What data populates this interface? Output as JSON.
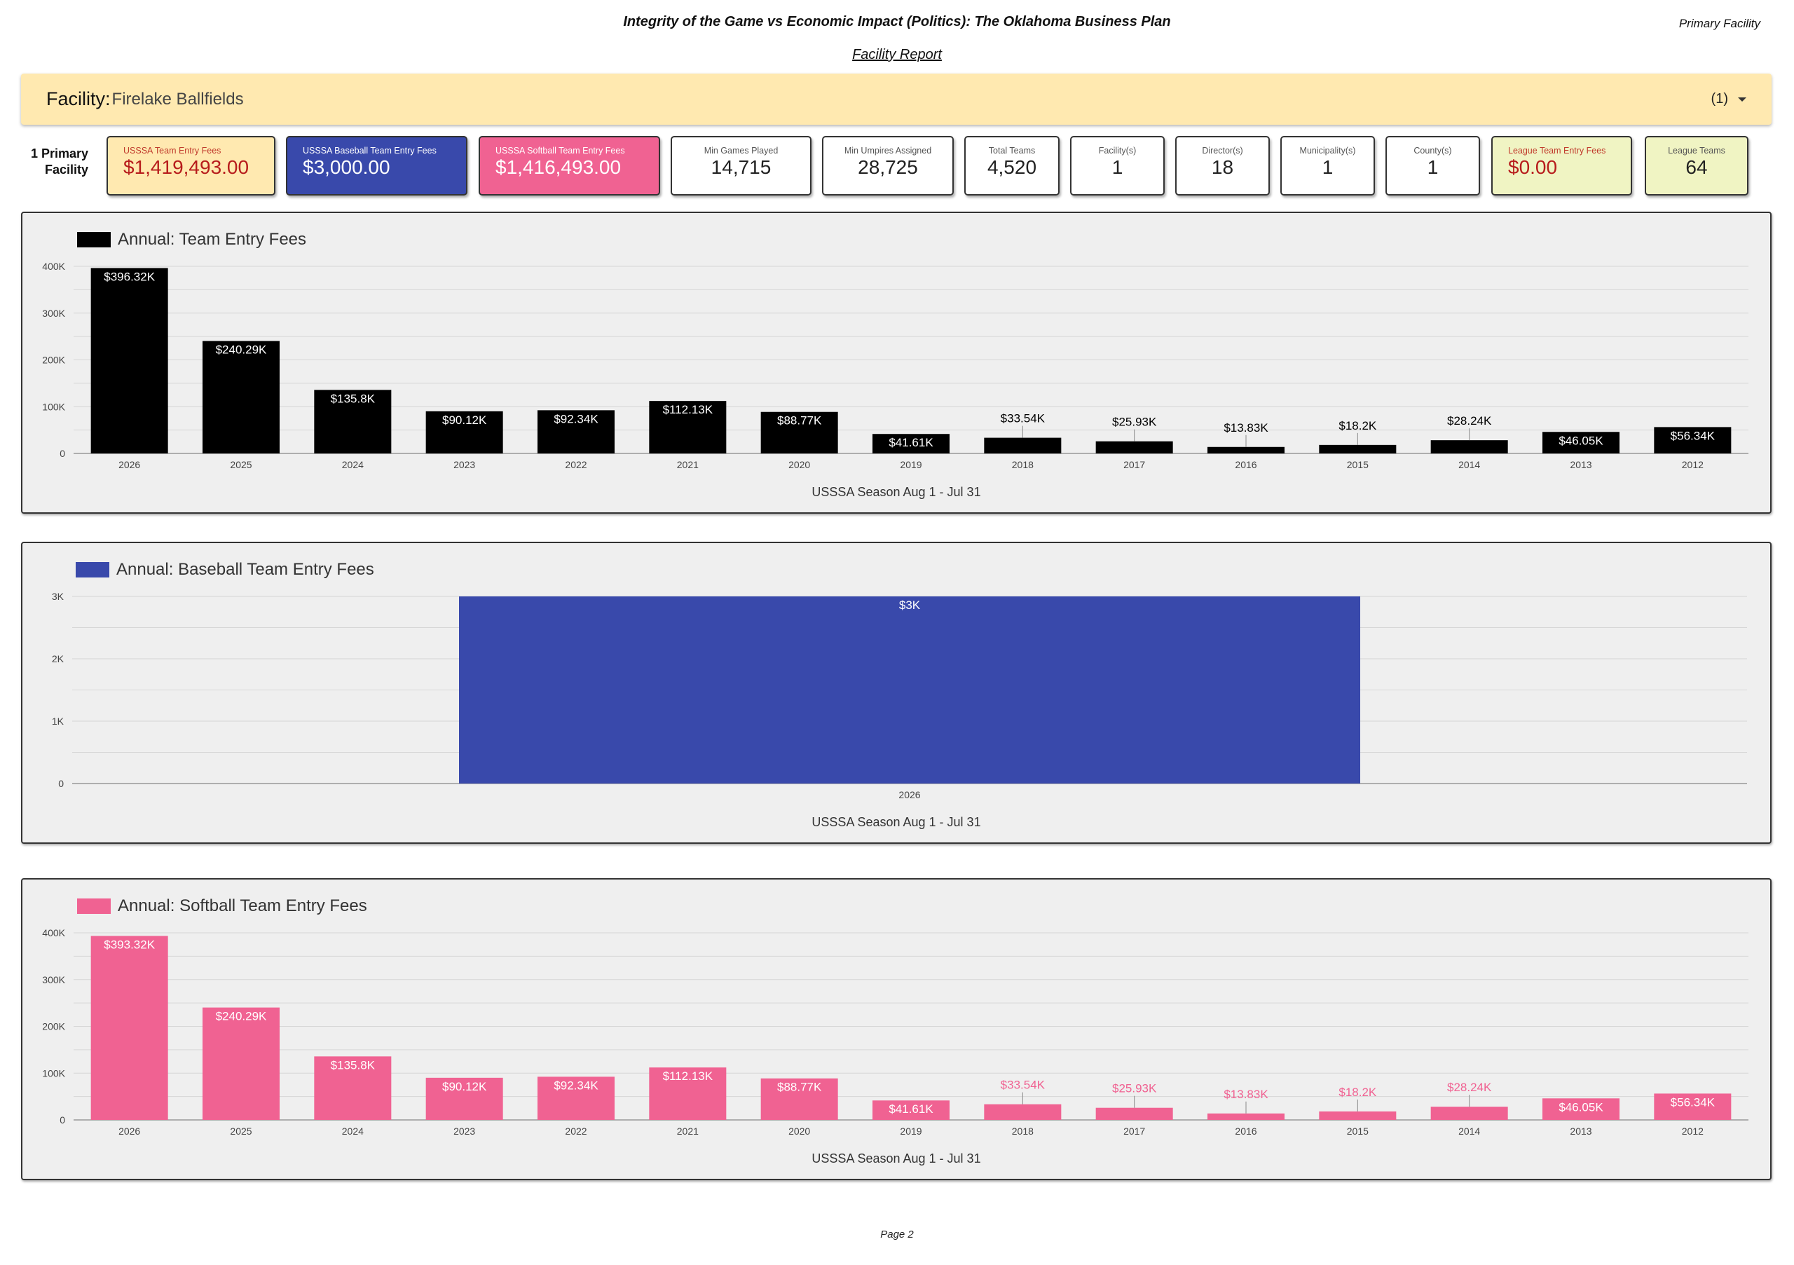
{
  "header": {
    "title": "Integrity of the Game vs Economic Impact (Politics): The Oklahoma Business Plan",
    "tag": "Primary Facility",
    "subtitle": "Facility Report"
  },
  "facility": {
    "label": "Facility",
    "separator": ":",
    "value": "Firelake Ballfields",
    "count": "(1)"
  },
  "side_label": {
    "line1": "1 Primary",
    "line2": "Facility"
  },
  "cards": [
    {
      "label": "USSSA Team Entry Fees",
      "value": "$1,419,493.00"
    },
    {
      "label": "USSSA Baseball Team Entry Fees",
      "value": "$3,000.00"
    },
    {
      "label": "USSSA Softball Team Entry Fees",
      "value": "$1,416,493.00"
    },
    {
      "label": "Min Games Played",
      "value": "14,715"
    },
    {
      "label": "Min Umpires Assigned",
      "value": "28,725"
    },
    {
      "label": "Total Teams",
      "value": "4,520"
    },
    {
      "label": "Facility(s)",
      "value": "1"
    },
    {
      "label": "Director(s)",
      "value": "18"
    },
    {
      "label": "Municipality(s)",
      "value": "1"
    },
    {
      "label": "County(s)",
      "value": "1"
    },
    {
      "label": "League Team Entry Fees",
      "value": "$0.00"
    },
    {
      "label": "League Teams",
      "value": "64"
    }
  ],
  "colors": {
    "total": "#000000",
    "baseball": "#3949ab",
    "softball": "#f06292",
    "facility_bg": "#ffe9b0"
  },
  "chart_data": [
    {
      "type": "bar",
      "title": "Annual: Team Entry Fees",
      "xlabel": "USSSA Season Aug 1 - Jul 31",
      "ylabel": "",
      "ylim": [
        0,
        400000
      ],
      "yticks": [
        0,
        100000,
        200000,
        300000,
        400000
      ],
      "ytick_labels": [
        "0",
        "100K",
        "200K",
        "300K",
        "400K"
      ],
      "grid": true,
      "legend": "top-left",
      "color": "#000000",
      "categories": [
        "2026",
        "2025",
        "2024",
        "2023",
        "2022",
        "2021",
        "2020",
        "2019",
        "2018",
        "2017",
        "2016",
        "2015",
        "2014",
        "2013",
        "2012"
      ],
      "values": [
        396320,
        240290,
        135800,
        90120,
        92340,
        112130,
        88770,
        41610,
        33540,
        25930,
        13830,
        18200,
        28240,
        46050,
        56340
      ],
      "data_labels": [
        "$396.32K",
        "$240.29K",
        "$135.8K",
        "$90.12K",
        "$92.34K",
        "$112.13K",
        "$88.77K",
        "$41.61K",
        "$33.54K",
        "$25.93K",
        "$13.83K",
        "$18.2K",
        "$28.24K",
        "$46.05K",
        "$56.34K"
      ]
    },
    {
      "type": "bar",
      "title": "Annual: Baseball Team Entry Fees",
      "xlabel": "USSSA Season Aug 1 - Jul 31",
      "ylabel": "",
      "ylim": [
        0,
        3000
      ],
      "yticks": [
        0,
        1000,
        2000,
        3000
      ],
      "ytick_labels": [
        "0",
        "1K",
        "2K",
        "3K"
      ],
      "grid": true,
      "legend": "top-left",
      "color": "#3949ab",
      "categories": [
        "2026"
      ],
      "values": [
        3000
      ],
      "data_labels": [
        "$3K"
      ]
    },
    {
      "type": "bar",
      "title": "Annual: Softball Team Entry Fees",
      "xlabel": "USSSA Season Aug 1 - Jul 31",
      "ylabel": "",
      "ylim": [
        0,
        400000
      ],
      "yticks": [
        0,
        100000,
        200000,
        300000,
        400000
      ],
      "ytick_labels": [
        "0",
        "100K",
        "200K",
        "300K",
        "400K"
      ],
      "grid": true,
      "legend": "top-left",
      "color": "#f06292",
      "categories": [
        "2026",
        "2025",
        "2024",
        "2023",
        "2022",
        "2021",
        "2020",
        "2019",
        "2018",
        "2017",
        "2016",
        "2015",
        "2014",
        "2013",
        "2012"
      ],
      "values": [
        393320,
        240290,
        135800,
        90120,
        92340,
        112130,
        88770,
        41610,
        33540,
        25930,
        13830,
        18200,
        28240,
        46050,
        56340
      ],
      "data_labels": [
        "$393.32K",
        "$240.29K",
        "$135.8K",
        "$90.12K",
        "$92.34K",
        "$112.13K",
        "$88.77K",
        "$41.61K",
        "$33.54K",
        "$25.93K",
        "$13.83K",
        "$18.2K",
        "$28.24K",
        "$46.05K",
        "$56.34K"
      ]
    }
  ],
  "footer": {
    "page": "Page 2"
  }
}
